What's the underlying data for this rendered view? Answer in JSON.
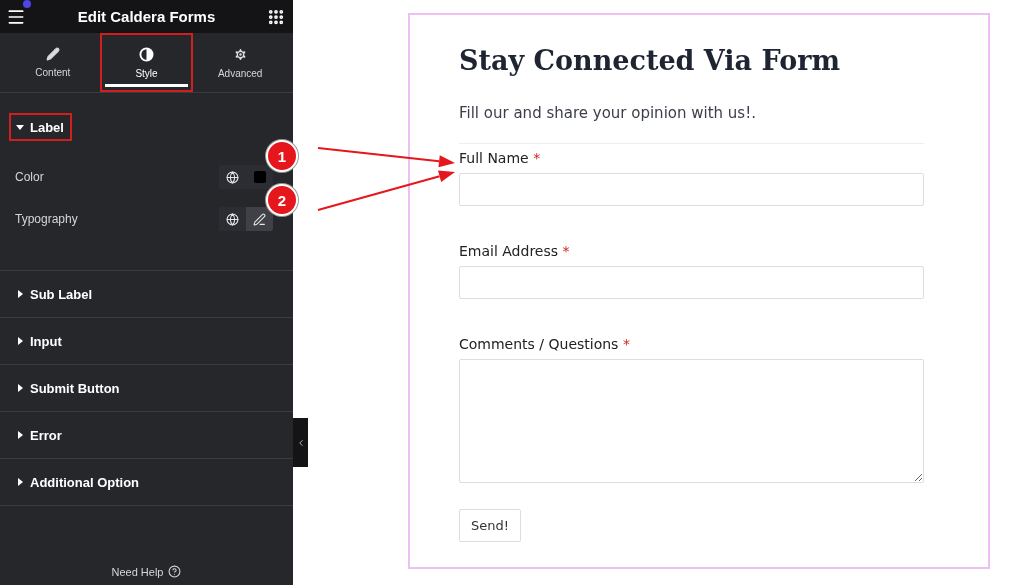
{
  "panel": {
    "title": "Edit Caldera Forms",
    "tabs": [
      {
        "label": "Content",
        "selected": false,
        "highlighted": false
      },
      {
        "label": "Style",
        "selected": true,
        "highlighted": true
      },
      {
        "label": "Advanced",
        "selected": false,
        "highlighted": false
      }
    ],
    "sections": [
      {
        "title": "Label",
        "expanded": true,
        "highlighted": true,
        "controls": [
          {
            "label": "Color",
            "kind": "color"
          },
          {
            "label": "Typography",
            "kind": "typography"
          }
        ]
      },
      {
        "title": "Sub Label",
        "expanded": false,
        "highlighted": false
      },
      {
        "title": "Input",
        "expanded": false,
        "highlighted": false
      },
      {
        "title": "Submit Button",
        "expanded": false,
        "highlighted": false
      },
      {
        "title": "Error",
        "expanded": false,
        "highlighted": false
      },
      {
        "title": "Additional Option",
        "expanded": false,
        "highlighted": false
      }
    ],
    "help": "Need Help"
  },
  "callouts": [
    {
      "number": "1"
    },
    {
      "number": "2"
    }
  ],
  "form": {
    "title": "Stay Connected Via Form",
    "subtitle": "Fill our and share your opinion with us!.",
    "fields": [
      {
        "label": "Full Name",
        "mark": "*",
        "kind": "input"
      },
      {
        "label": "Email Address",
        "mark": "*",
        "kind": "input"
      },
      {
        "label": "Comments / Questions",
        "mark": "*",
        "kind": "textarea"
      }
    ],
    "button": "Send!"
  }
}
